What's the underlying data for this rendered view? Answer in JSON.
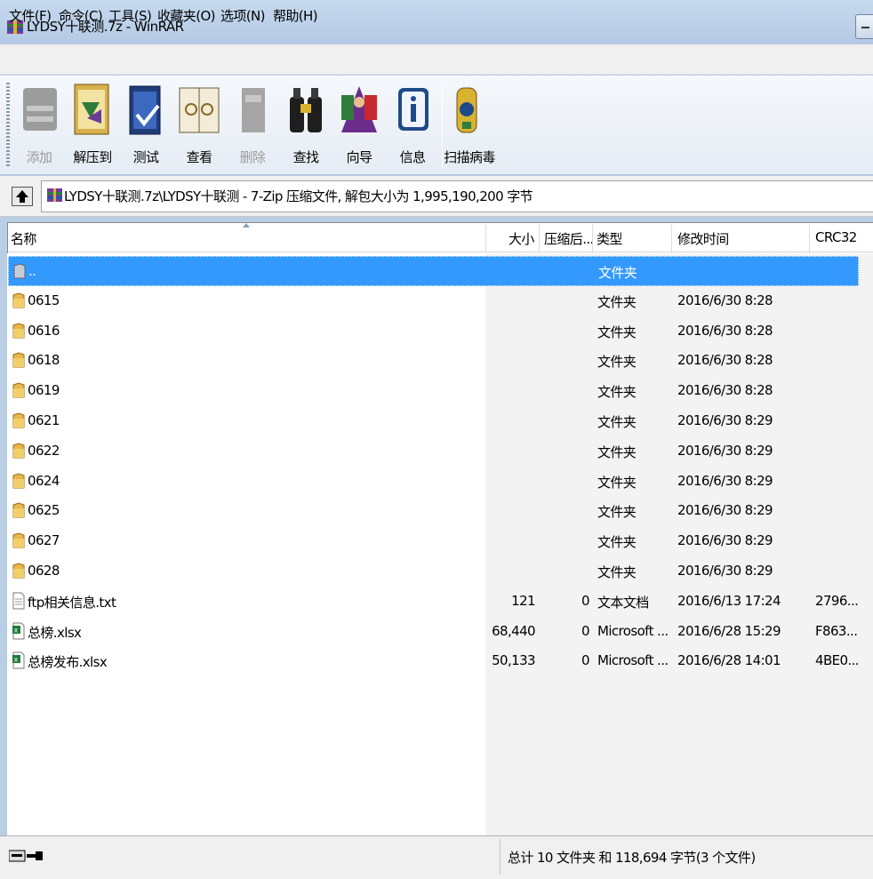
{
  "window": {
    "title": "LYDSY十联测.7z - WinRAR"
  },
  "menu": [
    "文件(F)",
    "命令(C)",
    "工具(S)",
    "收藏夹(O)",
    "选项(N)",
    "帮助(H)"
  ],
  "toolbar": [
    {
      "label": "添加",
      "icon": "add-icon",
      "enabled": false
    },
    {
      "label": "解压到",
      "icon": "extract-icon",
      "enabled": true
    },
    {
      "label": "测试",
      "icon": "test-icon",
      "enabled": true
    },
    {
      "label": "查看",
      "icon": "view-icon",
      "enabled": true
    },
    {
      "label": "删除",
      "icon": "delete-icon",
      "enabled": false
    },
    {
      "label": "查找",
      "icon": "find-icon",
      "enabled": true
    },
    {
      "label": "向导",
      "icon": "wizard-icon",
      "enabled": true
    },
    {
      "label": "信息",
      "icon": "info-icon",
      "enabled": true
    },
    {
      "label": "扫描病毒",
      "icon": "virus-scan-icon",
      "enabled": true
    }
  ],
  "address": {
    "text": "LYDSY十联测.7z\\LYDSY十联测 - 7-Zip 压缩文件, 解包大小为 1,995,190,200 字节"
  },
  "columns": {
    "name": "名称",
    "size": "大小",
    "packed": "压缩后...",
    "type": "类型",
    "modified": "修改时间",
    "crc": "CRC32"
  },
  "rows": [
    {
      "name": "..",
      "icon": "folder-up-icon",
      "size": "",
      "packed": "",
      "type": "文件夹",
      "modified": "",
      "crc": "",
      "selected": true
    },
    {
      "name": "0615",
      "icon": "folder-icon",
      "size": "",
      "packed": "",
      "type": "文件夹",
      "modified": "2016/6/30 8:28",
      "crc": ""
    },
    {
      "name": "0616",
      "icon": "folder-icon",
      "size": "",
      "packed": "",
      "type": "文件夹",
      "modified": "2016/6/30 8:28",
      "crc": ""
    },
    {
      "name": "0618",
      "icon": "folder-icon",
      "size": "",
      "packed": "",
      "type": "文件夹",
      "modified": "2016/6/30 8:28",
      "crc": ""
    },
    {
      "name": "0619",
      "icon": "folder-icon",
      "size": "",
      "packed": "",
      "type": "文件夹",
      "modified": "2016/6/30 8:28",
      "crc": ""
    },
    {
      "name": "0621",
      "icon": "folder-icon",
      "size": "",
      "packed": "",
      "type": "文件夹",
      "modified": "2016/6/30 8:29",
      "crc": ""
    },
    {
      "name": "0622",
      "icon": "folder-icon",
      "size": "",
      "packed": "",
      "type": "文件夹",
      "modified": "2016/6/30 8:29",
      "crc": ""
    },
    {
      "name": "0624",
      "icon": "folder-icon",
      "size": "",
      "packed": "",
      "type": "文件夹",
      "modified": "2016/6/30 8:29",
      "crc": ""
    },
    {
      "name": "0625",
      "icon": "folder-icon",
      "size": "",
      "packed": "",
      "type": "文件夹",
      "modified": "2016/6/30 8:29",
      "crc": ""
    },
    {
      "name": "0627",
      "icon": "folder-icon",
      "size": "",
      "packed": "",
      "type": "文件夹",
      "modified": "2016/6/30 8:29",
      "crc": ""
    },
    {
      "name": "0628",
      "icon": "folder-icon",
      "size": "",
      "packed": "",
      "type": "文件夹",
      "modified": "2016/6/30 8:29",
      "crc": ""
    },
    {
      "name": "ftp相关信息.txt",
      "icon": "text-file-icon",
      "size": "121",
      "packed": "0",
      "type": "文本文档",
      "modified": "2016/6/13 17:24",
      "crc": "2796..."
    },
    {
      "name": "总榜.xlsx",
      "icon": "excel-file-icon",
      "size": "68,440",
      "packed": "0",
      "type": "Microsoft ...",
      "modified": "2016/6/28 15:29",
      "crc": "F863..."
    },
    {
      "name": "总榜发布.xlsx",
      "icon": "excel-file-icon",
      "size": "50,133",
      "packed": "0",
      "type": "Microsoft ...",
      "modified": "2016/6/28 14:01",
      "crc": "4BE0..."
    }
  ],
  "status": {
    "text": "总计 10 文件夹 和 118,694 字节(3 个文件)"
  },
  "colors": {
    "selection": "#3399ff",
    "folder": "#e8b64c",
    "titlebar": "#c6d9ee"
  }
}
